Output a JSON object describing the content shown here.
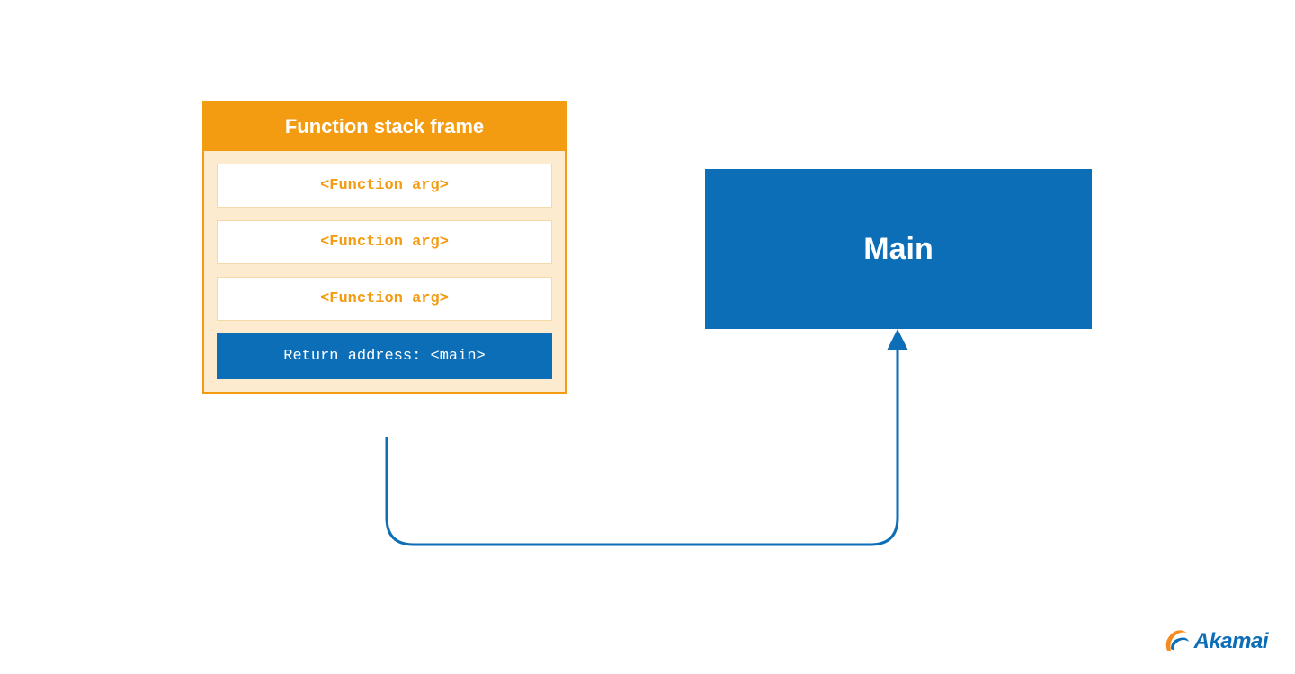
{
  "stack": {
    "title": "Function stack frame",
    "rows": {
      "arg1": "<Function arg>",
      "arg2": "<Function arg>",
      "arg3": "<Function arg>",
      "return": "Return address: <main>"
    }
  },
  "main": {
    "label": "Main"
  },
  "logo": {
    "text": "Akamai"
  },
  "colors": {
    "orange": "#f39c12",
    "orange_light": "#fdebd0",
    "blue": "#0d6eb8",
    "logo_orange": "#f68b1f"
  }
}
